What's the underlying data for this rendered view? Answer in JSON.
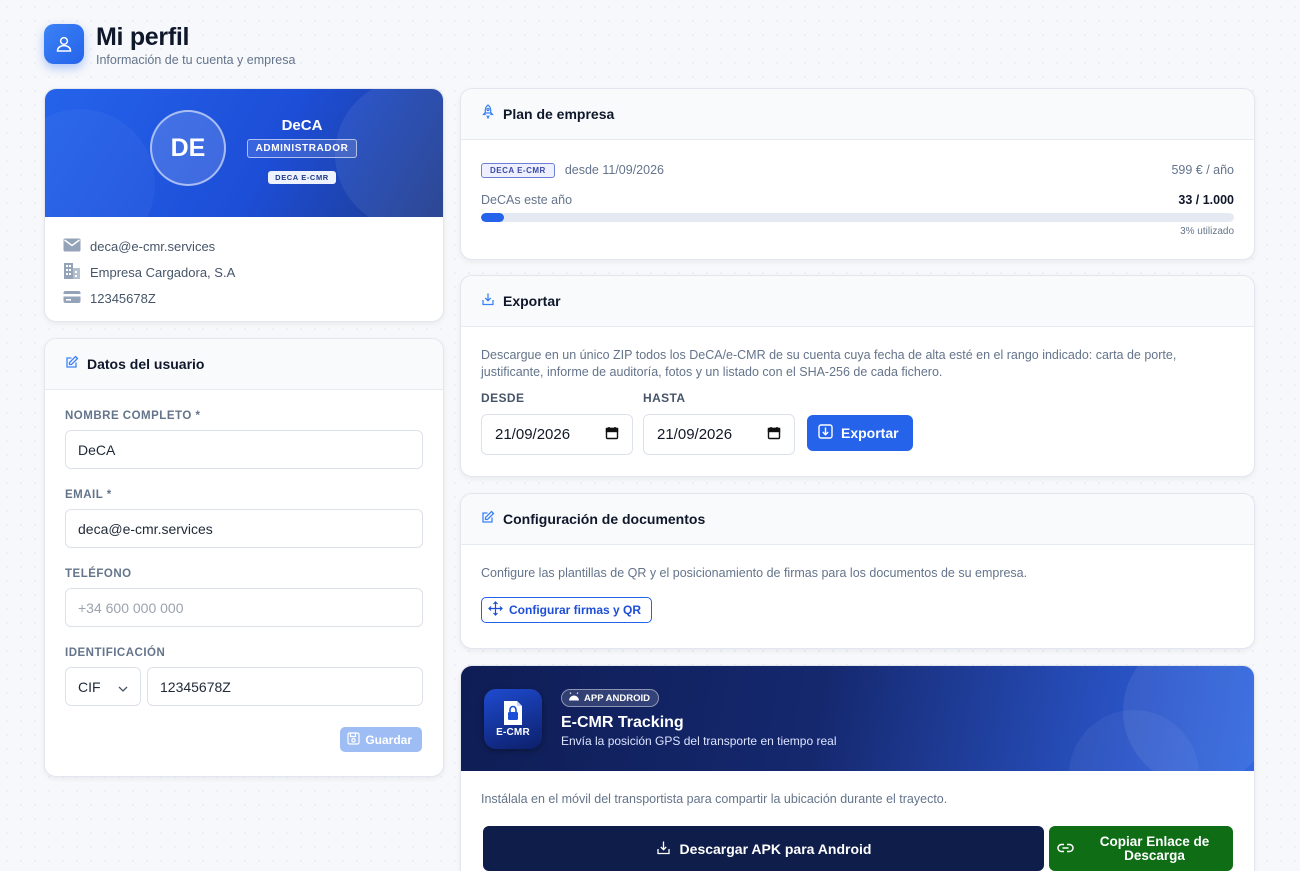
{
  "header": {
    "title": "Mi perfil",
    "subtitle": "Información de tu cuenta y empresa"
  },
  "profile": {
    "initials": "DE",
    "name": "DeCA",
    "role": "ADMINISTRADOR",
    "plan_badge": "DECA E-CMR",
    "email": "deca@e-cmr.services",
    "company": "Empresa Cargadora, S.A",
    "id_number": "12345678Z"
  },
  "user_form": {
    "title": "Datos del usuario",
    "full_name_label": "NOMBRE COMPLETO *",
    "full_name_value": "DeCA",
    "email_label": "EMAIL *",
    "email_value": "deca@e-cmr.services",
    "phone_label": "TELÉFONO",
    "phone_placeholder": "+34 600 000 000",
    "id_label": "IDENTIFICACIÓN",
    "id_type": "CIF",
    "id_value": "12345678Z",
    "save_label": "Guardar"
  },
  "plan": {
    "title": "Plan de empresa",
    "badge": "DECA E-CMR",
    "since": "desde 11/09/2026",
    "price": "599 € / año",
    "usage_label": "DeCAs este año",
    "usage_count": "33 / 1.000",
    "usage_percent": 3,
    "usage_text": "3% utilizado"
  },
  "export": {
    "title": "Exportar",
    "description": "Descargue en un único ZIP todos los DeCA/e-CMR de su cuenta cuya fecha de alta esté en el rango indicado: carta de porte, justificante, informe de auditoría, fotos y un listado con el SHA-256 de cada fichero.",
    "from_label": "DESDE",
    "from_value": "21/09/2026",
    "to_label": "HASTA",
    "to_value": "21/09/2026",
    "button_label": "Exportar"
  },
  "docs_config": {
    "title": "Configuración de documentos",
    "description": "Configure las plantillas de QR y el posicionamiento de firmas para los documentos de su empresa.",
    "button_label": "Configurar firmas y QR"
  },
  "android_app": {
    "chip": "APP ANDROID",
    "logo_text": "E-CMR",
    "title": "E-CMR Tracking",
    "subtitle": "Envía la posición GPS del transporte en tiempo real",
    "description": "Instálala en el móvil del transportista para compartir la ubicación durante el trayecto.",
    "download_label": "Descargar APK para Android",
    "copy_link_label": "Copiar Enlace de Descarga"
  },
  "colors": {
    "accent": "#2563eb",
    "navy": "#0f1d4a",
    "green": "#0f6d16"
  }
}
